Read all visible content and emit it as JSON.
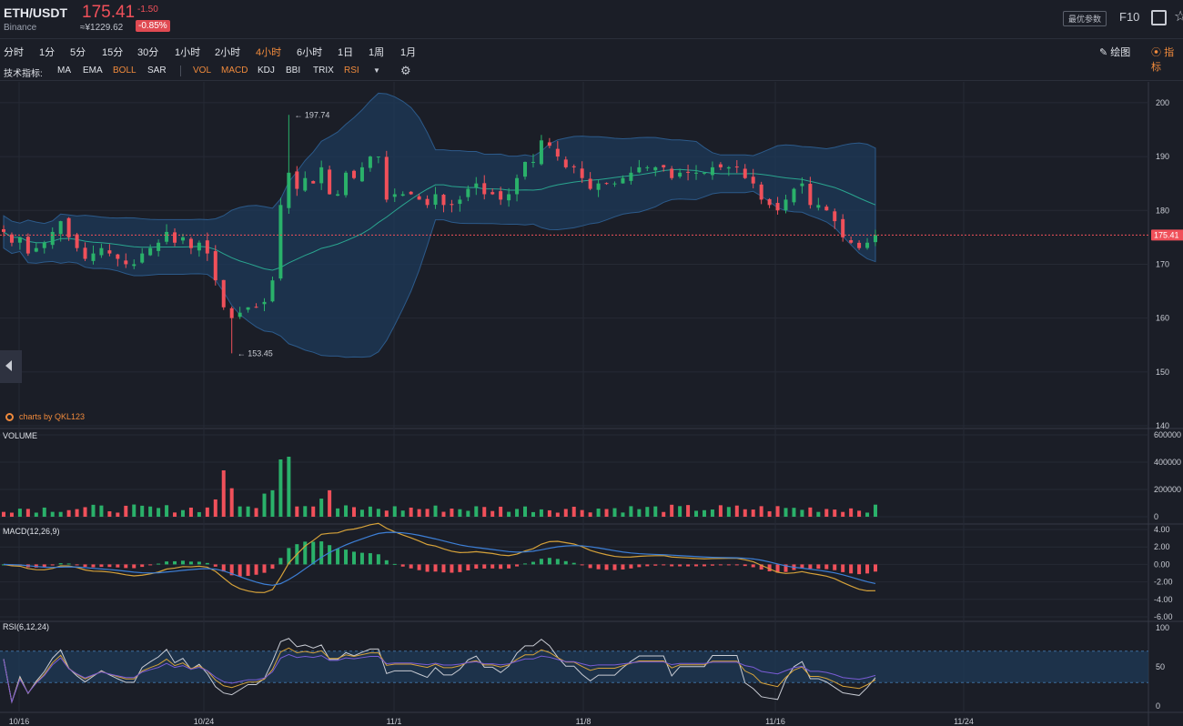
{
  "header": {
    "symbol": "ETH/USDT",
    "exchange": "Binance",
    "price": "175.41",
    "price_cny": "≈¥1229.62",
    "change": "-1.50",
    "change_pct": "-0.85%",
    "pref_button": "最优参数",
    "f10": "F10"
  },
  "periods": [
    "分时",
    "1分",
    "5分",
    "15分",
    "30分",
    "1小时",
    "2小时",
    "4小时",
    "6小时",
    "1日",
    "1周",
    "1月"
  ],
  "active_period": "4小时",
  "toolbar": {
    "draw_label": "绘图",
    "indicator_label": "指标"
  },
  "indicators": {
    "label": "技术指标:",
    "main": [
      "MA",
      "EMA",
      "BOLL",
      "SAR"
    ],
    "sub": [
      "VOL",
      "MACD",
      "KDJ",
      "BBI",
      "TRIX",
      "RSI"
    ],
    "active_main": [
      "BOLL"
    ],
    "active_sub": [
      "VOL",
      "MACD",
      "RSI"
    ]
  },
  "branding": "charts by QKL123",
  "colors": {
    "up": "#2ab16a",
    "down": "#f0505a",
    "accent": "#f08a3c",
    "boll_fill": "#1e3a5a"
  },
  "chart_data": {
    "type": "candlestick",
    "x_ticks": [
      "10/16",
      "10/24",
      "11/1",
      "11/8",
      "11/16",
      "11/24"
    ],
    "price_axis": {
      "ticks": [
        200,
        190,
        180,
        170,
        160,
        150,
        140
      ],
      "range": [
        140,
        201.5
      ]
    },
    "last_price": 175.41,
    "high_marker": 197.74,
    "low_marker": 153.45,
    "close_series": [
      176,
      174,
      175,
      172,
      173,
      174,
      176,
      178,
      175,
      173,
      171,
      172,
      173,
      172,
      171,
      170,
      170,
      172,
      173,
      174,
      176,
      174,
      175,
      173,
      174,
      172,
      167,
      162,
      160,
      161,
      162,
      162,
      163,
      167,
      181,
      187,
      184,
      186,
      185,
      188,
      183,
      183,
      187,
      186,
      188,
      190,
      190,
      182,
      183,
      183,
      183,
      182,
      181,
      183,
      181,
      181,
      182,
      184,
      185,
      183,
      183,
      182,
      183,
      186,
      189,
      189,
      193,
      192,
      190,
      188,
      188,
      186,
      184,
      185,
      185,
      185,
      186,
      187,
      188,
      188,
      188,
      188,
      186,
      187,
      187,
      187,
      187,
      188,
      188,
      188,
      188,
      186,
      185,
      182,
      181,
      180,
      182,
      184,
      185,
      181,
      181,
      180,
      178,
      175,
      174,
      173,
      174,
      175.41
    ],
    "volume_axis": {
      "ticks": [
        600000,
        400000,
        200000,
        0
      ]
    },
    "macd": {
      "label": "MACD(12,26,9)",
      "ticks": [
        "4.00",
        "2.00",
        "0.00",
        "-2.00",
        "-4.00",
        "-6.00"
      ]
    },
    "rsi": {
      "label": "RSI(6,12,24)",
      "ticks": [
        100,
        50,
        0
      ]
    },
    "volume_label": "VOLUME"
  }
}
